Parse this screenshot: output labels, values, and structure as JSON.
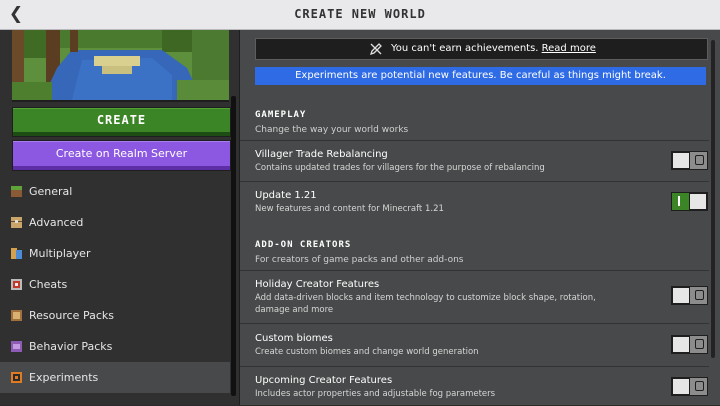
{
  "header": {
    "title": "CREATE NEW WORLD",
    "back_icon": "chevron-left-icon"
  },
  "sidebar": {
    "create_label": "CREATE",
    "realm_label": "Create on Realm Server",
    "items": [
      {
        "label": "General",
        "icon": "grass-block-icon"
      },
      {
        "label": "Advanced",
        "icon": "chest-icon"
      },
      {
        "label": "Multiplayer",
        "icon": "players-icon"
      },
      {
        "label": "Cheats",
        "icon": "command-block-icon"
      },
      {
        "label": "Resource Packs",
        "icon": "resource-pack-icon"
      },
      {
        "label": "Behavior Packs",
        "icon": "behavior-pack-icon"
      },
      {
        "label": "Experiments",
        "icon": "flask-icon"
      }
    ],
    "active_item": "Experiments"
  },
  "notice": {
    "text": "You can't earn achievements.",
    "link": "Read more"
  },
  "banner": {
    "text": "Experiments are potential new features. Be careful as things might break."
  },
  "gameplay": {
    "title": "GAMEPLAY",
    "subtitle": "Change the way your world works",
    "rows": [
      {
        "title": "Villager Trade Rebalancing",
        "desc": "Contains updated trades for villagers for the purpose of rebalancing",
        "enabled": false
      },
      {
        "title": "Update 1.21",
        "desc": "New features and content for Minecraft 1.21",
        "enabled": true
      }
    ]
  },
  "addon": {
    "title": "ADD-ON CREATORS",
    "subtitle": "For creators of game packs and other add-ons",
    "rows": [
      {
        "title": "Holiday Creator Features",
        "desc": "Add data-driven blocks and item technology to customize block shape, rotation, damage and more",
        "enabled": false
      },
      {
        "title": "Custom biomes",
        "desc": "Create custom biomes and change world generation",
        "enabled": false
      },
      {
        "title": "Upcoming Creator Features",
        "desc": "Includes actor properties and adjustable fog parameters",
        "enabled": false
      }
    ]
  },
  "colors": {
    "create_green": "#3c8527",
    "realm_purple": "#8c57e1",
    "banner_blue": "#2e6be5"
  }
}
